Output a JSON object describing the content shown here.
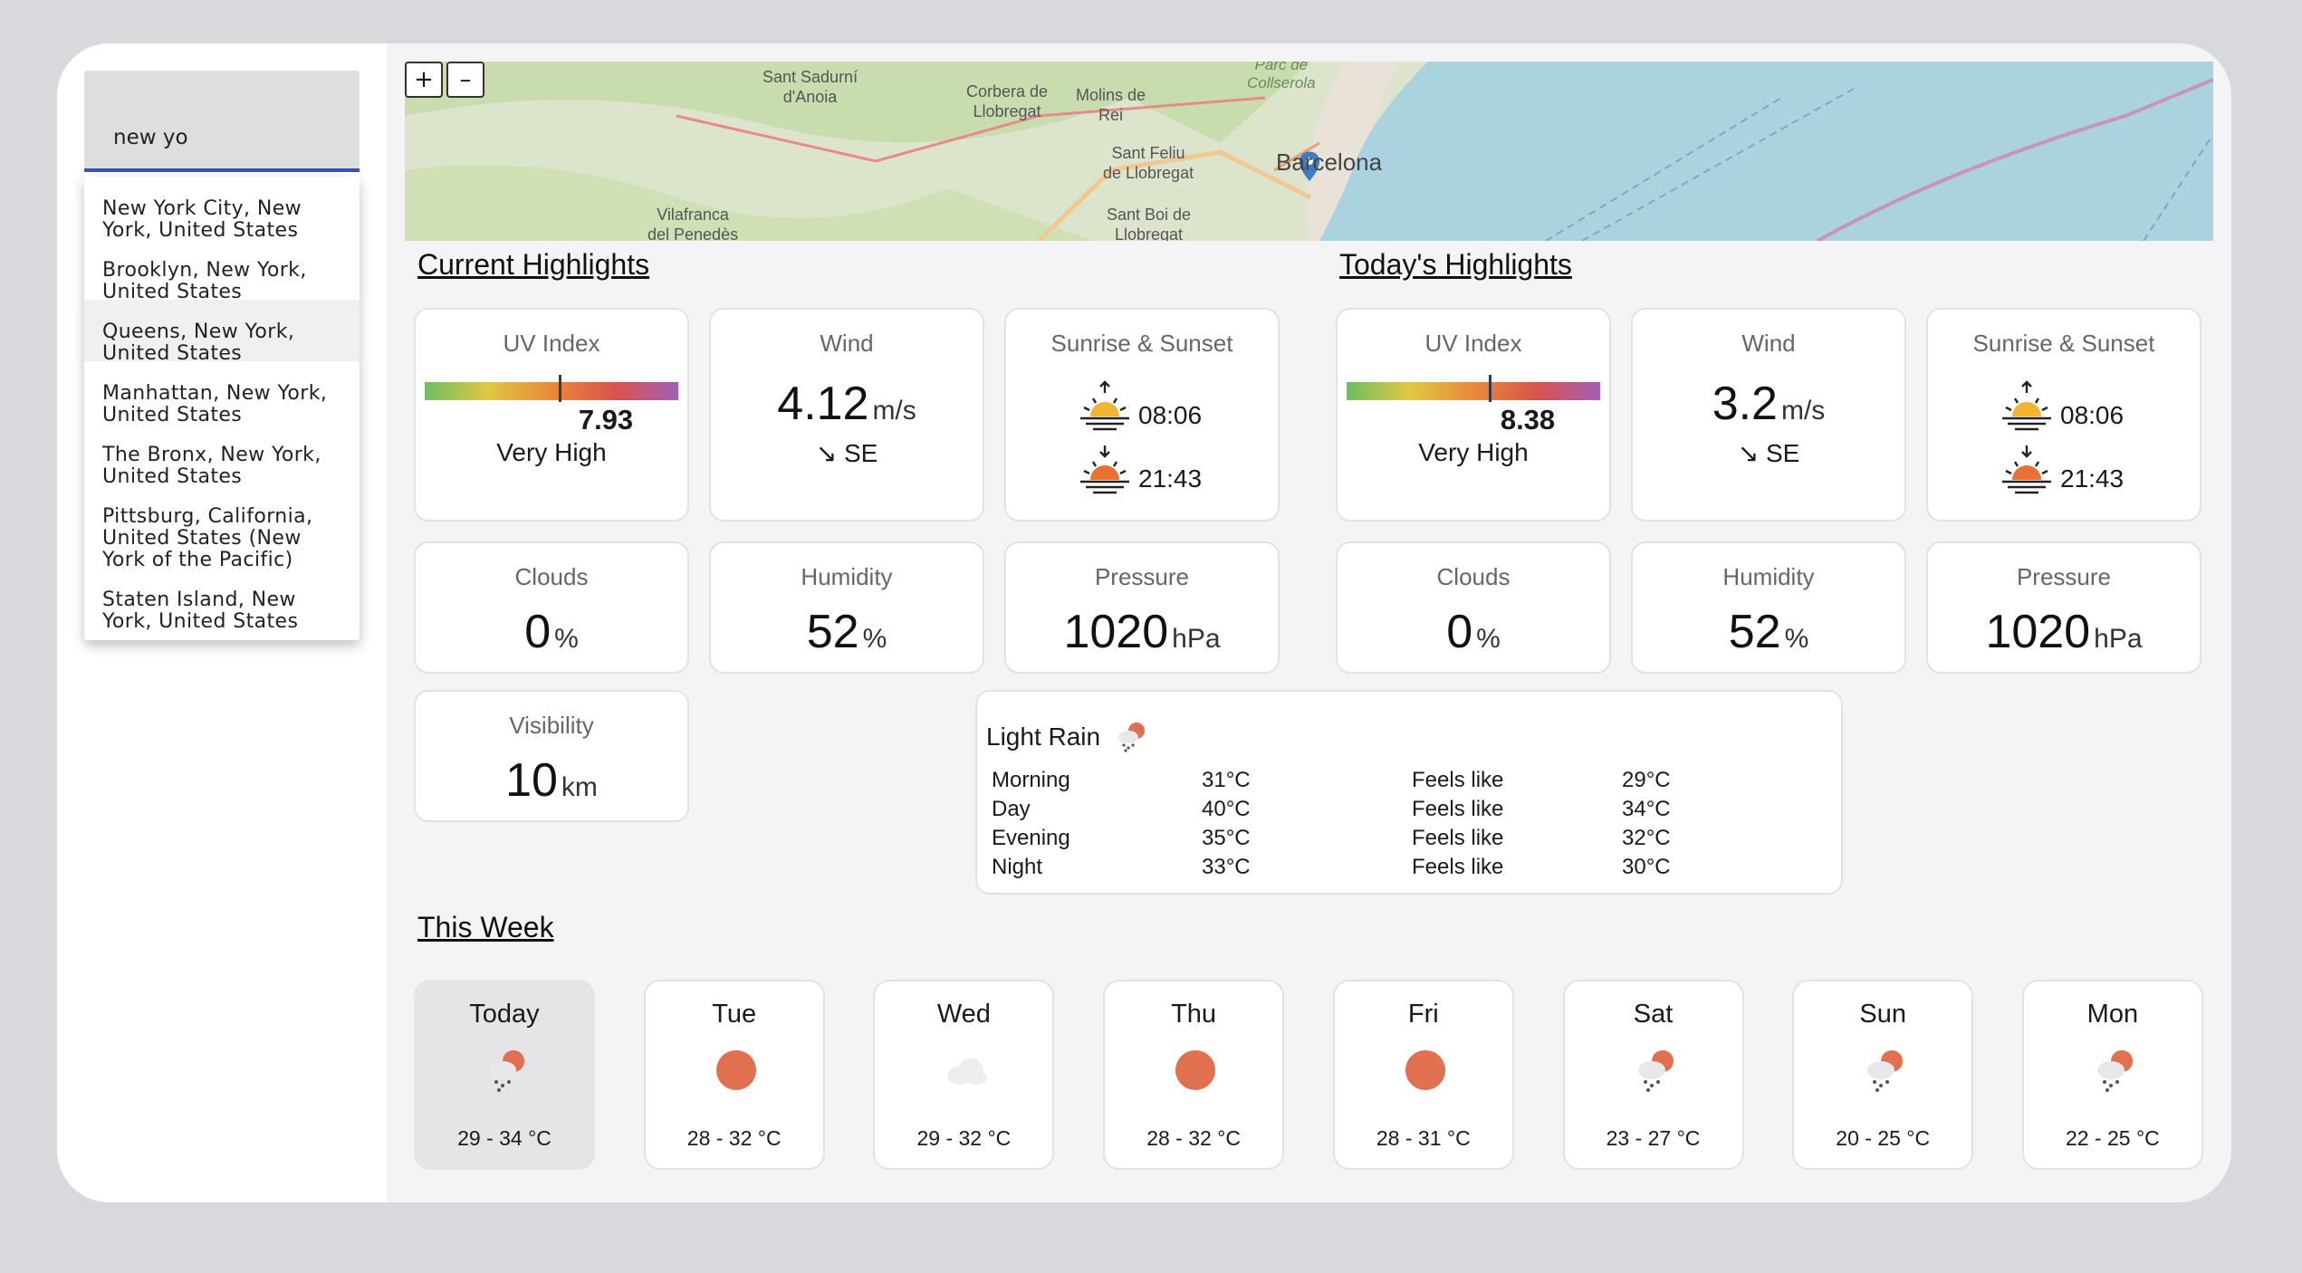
{
  "search": {
    "value": "new yo",
    "suggestions": [
      "New York City, New York, United States",
      "Brooklyn, New York, United States",
      "Queens, New York, United States",
      "Manhattan, New York, United States",
      "The Bronx, New York, United States",
      "Pittsburg, California, United States (New York of the Pacific)",
      "Staten Island, New York, United States"
    ],
    "suggestion_lines": [
      [
        "New York City, New",
        "York, United States"
      ],
      [
        "Brooklyn, New York,",
        "United States"
      ],
      [
        "Queens, New York,",
        "United States"
      ],
      [
        "Manhattan, New York,",
        "United States"
      ],
      [
        "The Bronx, New York,",
        "United States"
      ],
      [
        "Pittsburg, California,",
        "United States (New",
        "York of the Pacific)"
      ],
      [
        "Staten Island, New",
        "York, United States"
      ]
    ]
  },
  "map": {
    "zoom_in": "+",
    "zoom_out": "–",
    "labels": [
      "Sant Sadurní",
      "d'Anoia",
      "Corbera de",
      "Llobregat",
      "Molins de",
      "Rei",
      "Sant Feliu",
      "de Llobregat",
      "Sant Boi de",
      "Llobregat",
      "Vilafranca",
      "del Penedès",
      "Barcelona",
      "Parc de",
      "Collserola"
    ]
  },
  "current": {
    "title": "Current Highlights",
    "uv": {
      "label": "UV Index",
      "value": "7.93",
      "fraction": 0.53,
      "level": "Very High"
    },
    "wind": {
      "label": "Wind",
      "value": "4.12",
      "unit": "m/s",
      "direction": "↘ SE"
    },
    "sun": {
      "label": "Sunrise & Sunset",
      "sunrise": "08:06",
      "sunset": "21:43"
    },
    "clouds": {
      "label": "Clouds",
      "value": "0",
      "unit": "%"
    },
    "humidity": {
      "label": "Humidity",
      "value": "52",
      "unit": "%"
    },
    "pressure": {
      "label": "Pressure",
      "value": "1020",
      "unit": "hPa"
    },
    "visibility": {
      "label": "Visibility",
      "value": "10",
      "unit": "km"
    }
  },
  "today": {
    "title": "Today's Highlights",
    "uv": {
      "label": "UV Index",
      "value": "8.38",
      "fraction": 0.56,
      "level": "Very High"
    },
    "wind": {
      "label": "Wind",
      "value": "3.2",
      "unit": "m/s",
      "direction": "↘ SE"
    },
    "sun": {
      "label": "Sunrise & Sunset",
      "sunrise": "08:06",
      "sunset": "21:43"
    },
    "clouds": {
      "label": "Clouds",
      "value": "0",
      "unit": "%"
    },
    "humidity": {
      "label": "Humidity",
      "value": "52",
      "unit": "%"
    },
    "pressure": {
      "label": "Pressure",
      "value": "1020",
      "unit": "hPa"
    },
    "forecast": {
      "condition": "Light Rain",
      "icon": "light-rain-icon",
      "rows": [
        {
          "period": "Morning",
          "temp": "31°C",
          "feels_label": "Feels like",
          "feels": "29°C"
        },
        {
          "period": "Day",
          "temp": "40°C",
          "feels_label": "Feels like",
          "feels": "34°C"
        },
        {
          "period": "Evening",
          "temp": "35°C",
          "feels_label": "Feels like",
          "feels": "32°C"
        },
        {
          "period": "Night",
          "temp": "33°C",
          "feels_label": "Feels like",
          "feels": "30°C"
        }
      ]
    }
  },
  "week": {
    "title": "This Week",
    "days": [
      {
        "name": "Today",
        "icon": "light-rain-icon",
        "range": "29 - 34 °C"
      },
      {
        "name": "Tue",
        "icon": "sun-icon",
        "range": "28 - 32 °C"
      },
      {
        "name": "Wed",
        "icon": "cloud-icon",
        "range": "29 - 32 °C"
      },
      {
        "name": "Thu",
        "icon": "sun-icon",
        "range": "28 - 32 °C"
      },
      {
        "name": "Fri",
        "icon": "sun-icon",
        "range": "28 - 31 °C"
      },
      {
        "name": "Sat",
        "icon": "light-rain-icon",
        "range": "23 - 27 °C"
      },
      {
        "name": "Sun",
        "icon": "light-rain-icon",
        "range": "20 - 25 °C"
      },
      {
        "name": "Mon",
        "icon": "light-rain-icon",
        "range": "22 - 25 °C"
      }
    ]
  },
  "colors": {
    "accent": "#3f51b5",
    "sun": "#e07050",
    "uv_marker": "#2c3e55",
    "water": "#aad3df"
  }
}
